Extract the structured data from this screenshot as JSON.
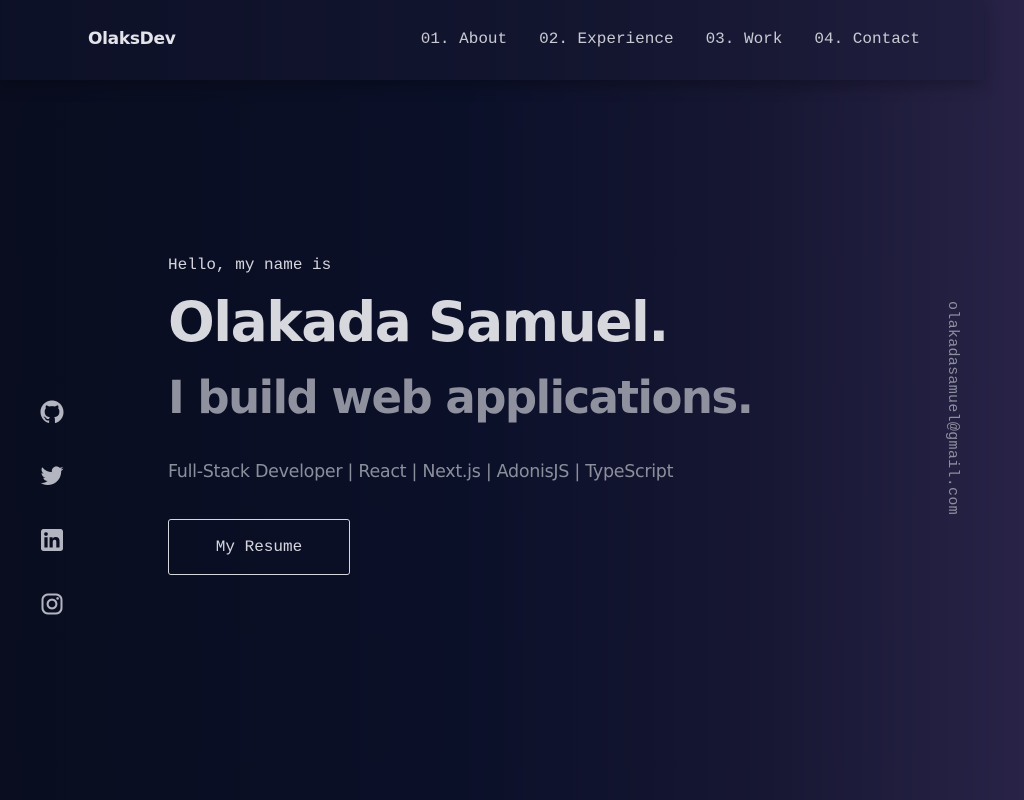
{
  "header": {
    "logo": "OlaksDev",
    "nav": [
      {
        "label": "01. About"
      },
      {
        "label": "02. Experience"
      },
      {
        "label": "03. Work"
      },
      {
        "label": "04. Contact"
      }
    ]
  },
  "socials": [
    {
      "icon": "github-icon"
    },
    {
      "icon": "twitter-icon"
    },
    {
      "icon": "linkedin-icon"
    },
    {
      "icon": "instagram-icon"
    }
  ],
  "hero": {
    "greeting": "Hello, my name is",
    "name": "Olakada Samuel.",
    "tagline": "I build web applications.",
    "skills": "Full-Stack Developer | React | Next.js | AdonisJS | TypeScript",
    "resume_label": "My Resume"
  },
  "email": "olakadasamuel@gmail.com",
  "colors": {
    "background_start": "#090d1f",
    "background_end": "#282347",
    "text_primary": "#d7d8de",
    "text_muted": "#8f929e"
  }
}
